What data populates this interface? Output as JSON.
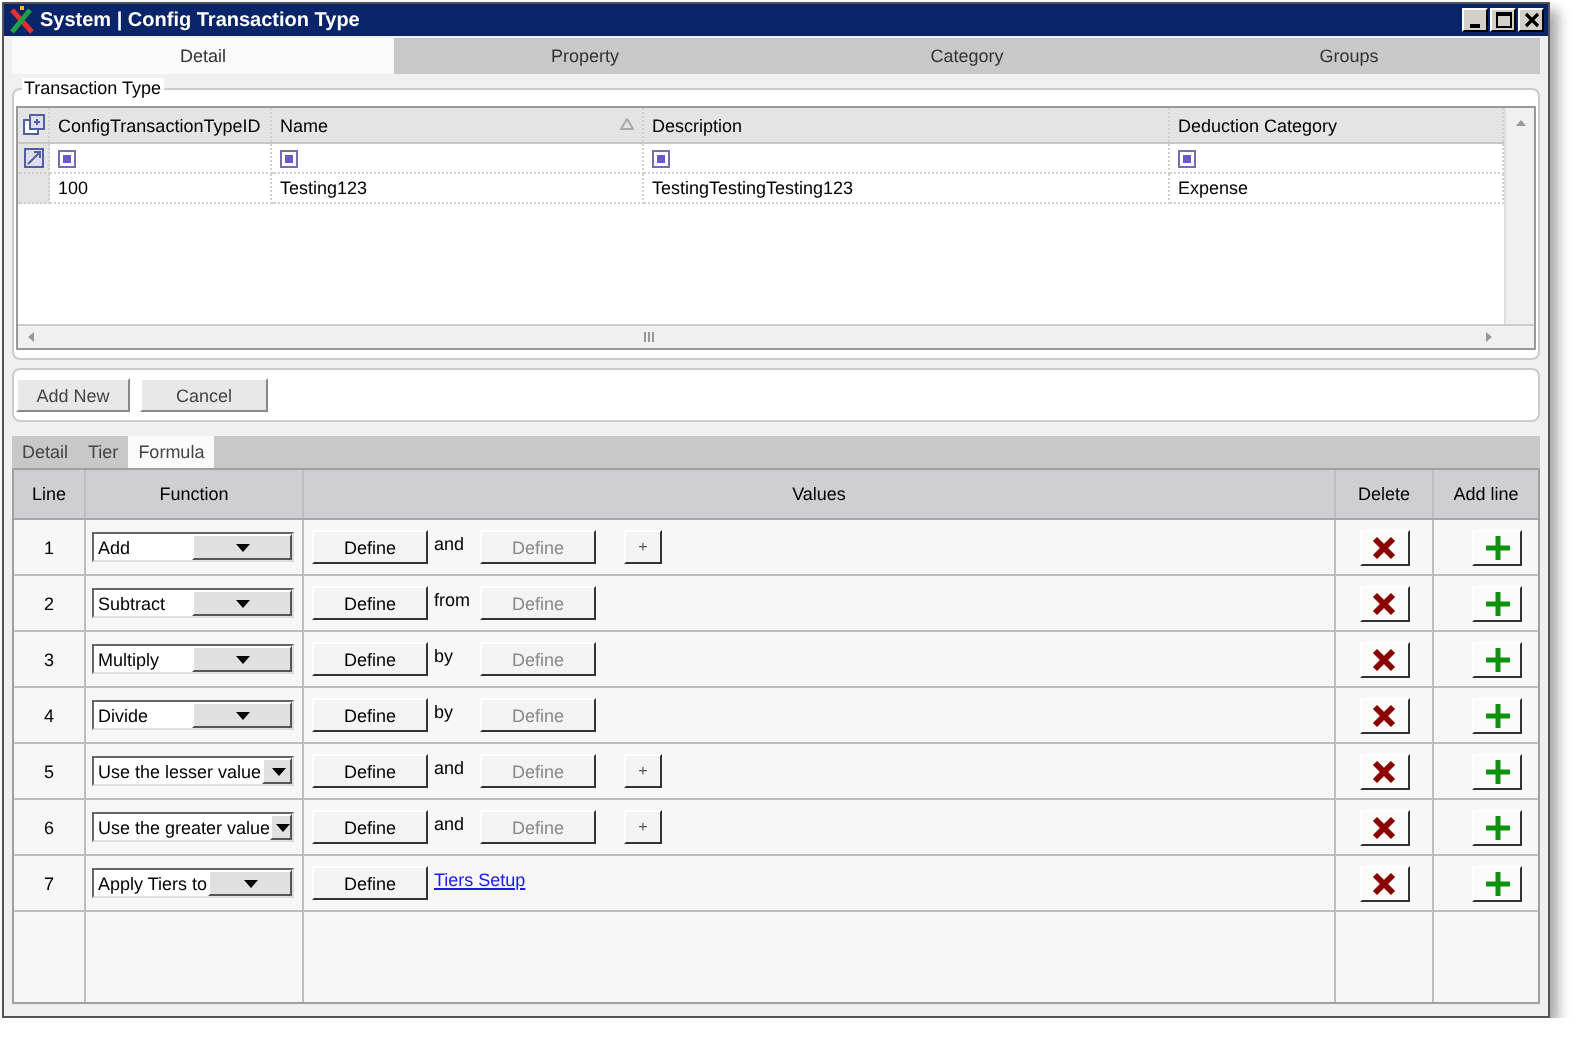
{
  "window": {
    "title": "System | Config Transaction Type"
  },
  "tabs": [
    {
      "label": "Detail",
      "selected": true
    },
    {
      "label": "Property",
      "selected": false
    },
    {
      "label": "Category",
      "selected": false
    },
    {
      "label": "Groups",
      "selected": false
    }
  ],
  "group": {
    "title": "Transaction Type"
  },
  "grid": {
    "columns": [
      "ConfigTransactionTypeID",
      "Name",
      "Description",
      "Deduction Category"
    ],
    "rows": [
      {
        "cells": [
          "100",
          "Testing123",
          "TestingTestingTesting123",
          "Expense"
        ]
      }
    ]
  },
  "buttons": [
    "Add New",
    "Cancel"
  ],
  "subtabs": [
    {
      "label": "Detail",
      "selected": false
    },
    {
      "label": "Tier",
      "selected": false
    },
    {
      "label": "Formula",
      "selected": true
    }
  ],
  "formula": {
    "columns": [
      "Line",
      "Function",
      "Values",
      "Delete",
      "Add line"
    ],
    "rows": [
      {
        "line": "1",
        "function": "Add",
        "values": [
          {
            "kind": "define",
            "label": "Define",
            "disabled": false
          },
          {
            "kind": "word",
            "label": "and"
          },
          {
            "kind": "define",
            "label": "Define",
            "disabled": true
          },
          {
            "kind": "plus",
            "label": "+"
          }
        ]
      },
      {
        "line": "2",
        "function": "Subtract",
        "values": [
          {
            "kind": "define",
            "label": "Define",
            "disabled": false
          },
          {
            "kind": "word",
            "label": "from"
          },
          {
            "kind": "define",
            "label": "Define",
            "disabled": true
          }
        ]
      },
      {
        "line": "3",
        "function": "Multiply",
        "values": [
          {
            "kind": "define",
            "label": "Define",
            "disabled": false
          },
          {
            "kind": "word",
            "label": "by"
          },
          {
            "kind": "define",
            "label": "Define",
            "disabled": true
          }
        ]
      },
      {
        "line": "4",
        "function": "Divide",
        "values": [
          {
            "kind": "define",
            "label": "Define",
            "disabled": false
          },
          {
            "kind": "word",
            "label": "by"
          },
          {
            "kind": "define",
            "label": "Define",
            "disabled": true
          }
        ]
      },
      {
        "line": "5",
        "function": "Use the lesser value",
        "values": [
          {
            "kind": "define",
            "label": "Define",
            "disabled": false
          },
          {
            "kind": "word",
            "label": "and"
          },
          {
            "kind": "define",
            "label": "Define",
            "disabled": true
          },
          {
            "kind": "plus",
            "label": "+"
          }
        ]
      },
      {
        "line": "6",
        "function": "Use the greater value",
        "values": [
          {
            "kind": "define",
            "label": "Define",
            "disabled": false
          },
          {
            "kind": "word",
            "label": "and"
          },
          {
            "kind": "define",
            "label": "Define",
            "disabled": true
          },
          {
            "kind": "plus",
            "label": "+"
          }
        ]
      },
      {
        "line": "7",
        "function": "Apply Tiers to",
        "values": [
          {
            "kind": "define",
            "label": "Define",
            "disabled": false
          },
          {
            "kind": "link",
            "label": "Tiers Setup"
          }
        ]
      }
    ]
  }
}
